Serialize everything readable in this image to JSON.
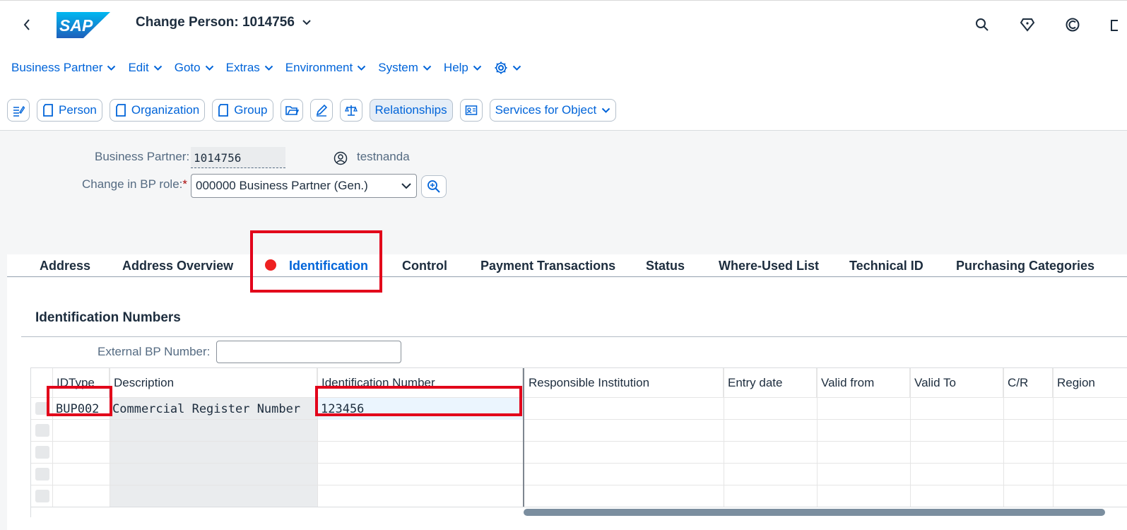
{
  "shell": {
    "title": "Change Person: 1014756",
    "logo_text": "SAP",
    "icons": [
      "search-icon",
      "diamond-icon",
      "copilot-icon"
    ]
  },
  "menu": [
    {
      "label": "Business Partner"
    },
    {
      "label": "Edit"
    },
    {
      "label": "Goto"
    },
    {
      "label": "Extras"
    },
    {
      "label": "Environment"
    },
    {
      "label": "System"
    },
    {
      "label": "Help"
    }
  ],
  "toolbar": {
    "person": "Person",
    "organization": "Organization",
    "group": "Group",
    "relationships": "Relationships",
    "services": "Services for Object"
  },
  "header": {
    "bp_label": "Business Partner:",
    "bp_value": "1014756",
    "user": "testnanda",
    "role_label": "Change in BP role:",
    "role_required": "*",
    "role_value": "000000 Business Partner (Gen.)"
  },
  "tabs": [
    {
      "label": "Address"
    },
    {
      "label": "Address Overview"
    },
    {
      "label": "Identification",
      "active": true,
      "has_error": true
    },
    {
      "label": "Control"
    },
    {
      "label": "Payment Transactions"
    },
    {
      "label": "Status"
    },
    {
      "label": "Where-Used List"
    },
    {
      "label": "Technical ID"
    },
    {
      "label": "Purchasing Categories"
    }
  ],
  "section": {
    "title": "Identification Numbers",
    "ext_label": "External BP Number:",
    "ext_value": ""
  },
  "table": {
    "columns": [
      "IDType",
      "Description",
      "Identification Number",
      "Responsible Institution",
      "Entry date",
      "Valid from",
      "Valid To",
      "C/R",
      "Region"
    ],
    "rows": [
      {
        "idtype": "BUP002",
        "description": "Commercial Register Number",
        "id_number": "123456"
      }
    ]
  },
  "colors": {
    "accent": "#0064d9",
    "highlight": "#e2001a",
    "error": "#ee2121"
  }
}
